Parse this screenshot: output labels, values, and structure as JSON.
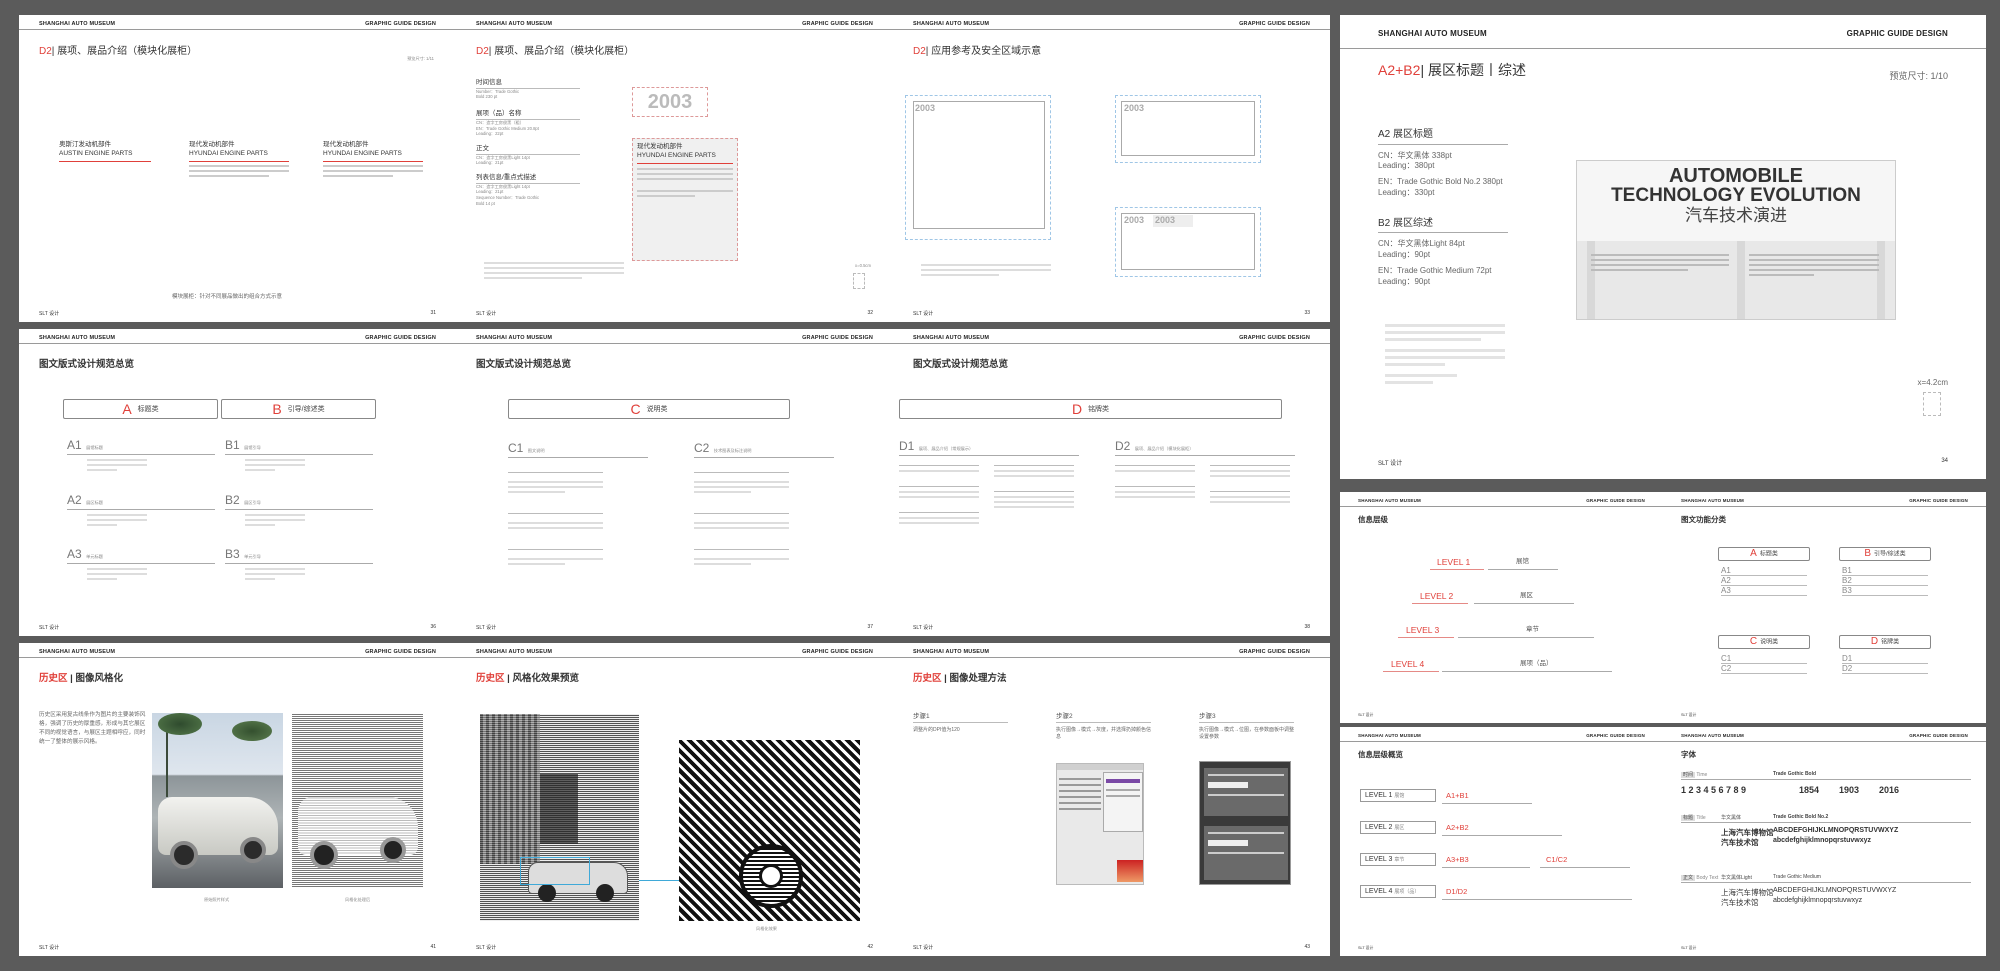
{
  "header": {
    "museum": "SHANGHAI AUTO MUSEUM",
    "guide": "GRAPHIC GUIDE DESIGN"
  },
  "footer": {
    "brand": "SLT 设计"
  },
  "p31": {
    "num": "31",
    "title_code": "D2",
    "title": "展项、展品介绍（模块化展柜）",
    "size": "预览尺寸: 1/11",
    "cards": [
      {
        "cn": "奥斯汀发动机部件",
        "en": "AUSTIN ENGINE PARTS"
      },
      {
        "cn": "现代发动机部件",
        "en": "HYUNDAI ENGINE PARTS"
      },
      {
        "cn": "现代发动机部件",
        "en": "HYUNDAI ENGINE PARTS"
      }
    ],
    "note": "模块展柜：针对不同展品做出的组合方式示意"
  },
  "p32": {
    "num": "32",
    "title_code": "D2",
    "title": "展项、展品介绍（模块化展柜）",
    "year": "2003",
    "l1": "时间信息",
    "l1a": "Number：Trade Gothic",
    "l1b": "Bold 230 pt",
    "l2": "展项（品）名称",
    "l2a": "CN：造字工房俊黑（粗）",
    "l2b": "EN：Trade Gothic Medium 20.8pt",
    "l2c": "Leading：22pt",
    "l3": "正文",
    "l3a": "CN：造字工房俊黑Light 14pt",
    "l3b": "Leading：21pt",
    "l4": "列表信息/重点式描述",
    "l4a": "CN：造字工房俊黑Light 14pt",
    "l4b": "Leading：21pt",
    "l4c": "Sequence Number：Trade Gothic",
    "l4d": "Bold 14 pt",
    "card_cn": "现代发动机部件",
    "card_en": "HYUNDAI ENGINE PARTS",
    "xsize": "x=0.5cm"
  },
  "p33": {
    "num": "33",
    "title_code": "D2",
    "title": "应用参考及安全区域示意",
    "year": "2003"
  },
  "p34": {
    "num": "34",
    "title_code": "A2+B2",
    "title": "展区标题丨综述",
    "size": "预览尺寸: 1/10",
    "s1": "A2 展区标题",
    "s1a": "CN：华文黑体 338pt",
    "s1b": "Leading：380pt",
    "s1c": "EN：Trade Gothic Bold No.2 380pt",
    "s1d": "Leading：330pt",
    "s2": "B2 展区综述",
    "s2a": "CN：华文黑体Light 84pt",
    "s2b": "Leading：90pt",
    "s2c": "EN：Trade Gothic Medium 72pt",
    "s2d": "Leading：90pt",
    "poster1": "AUTOMOBILE",
    "poster2": "TECHNOLOGY EVOLUTION",
    "poster3": "汽车技术演进",
    "xsize": "x=4.2cm"
  },
  "p36": {
    "num": "36",
    "title": "图文版式设计规范总览",
    "boxA_letter": "A",
    "boxA": "标题类",
    "boxB_letter": "B",
    "boxB": "引导/综述类",
    "items": [
      {
        "code": "A1",
        "name": "展馆标题"
      },
      {
        "code": "B1",
        "name": "展馆引导"
      },
      {
        "code": "A2",
        "name": "展区标题"
      },
      {
        "code": "B2",
        "name": "展区引导"
      },
      {
        "code": "A3",
        "name": "单元标题"
      },
      {
        "code": "B3",
        "name": "单元引导"
      }
    ]
  },
  "p37": {
    "num": "37",
    "title": "图文版式设计规范总览",
    "box_letter": "C",
    "box": "说明类",
    "c1": "C1",
    "c1n": "图文说明",
    "c2": "C2",
    "c2n": "技术图表及标注说明"
  },
  "p38": {
    "num": "38",
    "title": "图文版式设计规范总览",
    "box_letter": "D",
    "box": "铭牌类",
    "d1": "D1",
    "d1n": "展项、展品介绍（常规展示）",
    "d2": "D2",
    "d2n": "展项、展品介绍（模块化展柜）"
  },
  "p41": {
    "num": "41",
    "title_red": "历史区",
    "title": "图像风格化",
    "body": "历史区采用复古线条作为图片的主要装饰风格，强调了历史的厚重感，形成与其它展区不同的视觉语言，与展区主题相呼应，同时统一了整体的展示风格。",
    "cap1": "原始照片样式",
    "cap2": "风格化处理后"
  },
  "p42": {
    "num": "42",
    "title_red": "历史区",
    "title": "风格化效果预览",
    "cap": "风格化效果"
  },
  "p43": {
    "num": "43",
    "title_red": "历史区",
    "title": "图像处理方法",
    "s1": "步骤1",
    "s1d": "调整片的DPI值为120",
    "s2": "步骤2",
    "s2d": "执行图像→模式→灰度，并选择扔掉颜色信息",
    "s3": "步骤3",
    "s3d": "执行图像→模式→位图，在参数面板中调整设置参数"
  },
  "p47": {
    "title": "信息层级",
    "levels": [
      {
        "code": "LEVEL 1",
        "name": "展馆"
      },
      {
        "code": "LEVEL 2",
        "name": "展区"
      },
      {
        "code": "LEVEL 3",
        "name": "章节"
      },
      {
        "code": "LEVEL 4",
        "name": "展项（品）"
      }
    ]
  },
  "p48": {
    "title": "图文功能分类",
    "a": "A",
    "an": "标题类",
    "b": "B",
    "bn": "引导/综述类",
    "c": "C",
    "cn": "说明类",
    "d": "D",
    "dn": "铭牌类",
    "a_items": [
      "A1",
      "A2",
      "A3"
    ],
    "b_items": [
      "B1",
      "B2",
      "B3"
    ],
    "c_items": [
      "C1",
      "C2"
    ],
    "d_items": [
      "D1",
      "D2"
    ]
  },
  "p49": {
    "title": "信息层级概览",
    "rows": [
      {
        "code": "LEVEL 1",
        "name": "展馆",
        "map": "A1+B1"
      },
      {
        "code": "LEVEL 2",
        "name": "展区",
        "map": "A2+B2"
      },
      {
        "code": "LEVEL 3",
        "name": "章节",
        "map": "A3+B3",
        "map2": "C1/C2"
      },
      {
        "code": "LEVEL 4",
        "name": "展项（品）",
        "map": "D1/D2"
      }
    ]
  },
  "p50": {
    "title": "字体",
    "r1": "时间",
    "r1en": "Time",
    "r1font": "Trade Gothic Bold",
    "digits": "1 2 3 4 5 6 7 8 9",
    "y1": "1854",
    "y2": "1903",
    "y3": "2016",
    "r2": "标题",
    "r2en": "Title",
    "r2cn": "华文黑体",
    "r2font": "Trade Gothic Bold No.2",
    "r2sample": "上海汽车博物馆",
    "r2sample2": "汽车技术馆",
    "r2abc": "ABCDEFGHIJKLMNOPQRSTUVWXYZ",
    "r2lower": "abcdefghijklmnopqrstuvwxyz",
    "r3": "正文",
    "r3en": "Body Text",
    "r3cn": "华文黑体Light",
    "r3font": "Trade Gothic Medium",
    "r3sample": "上海汽车博物馆",
    "r3sample2": "汽车技术馆",
    "r3abc": "ABCDEFGHIJKLMNOPQRSTUVWXYZ",
    "r3lower": "abcdefghijklmnopqrstuvwxyz"
  }
}
